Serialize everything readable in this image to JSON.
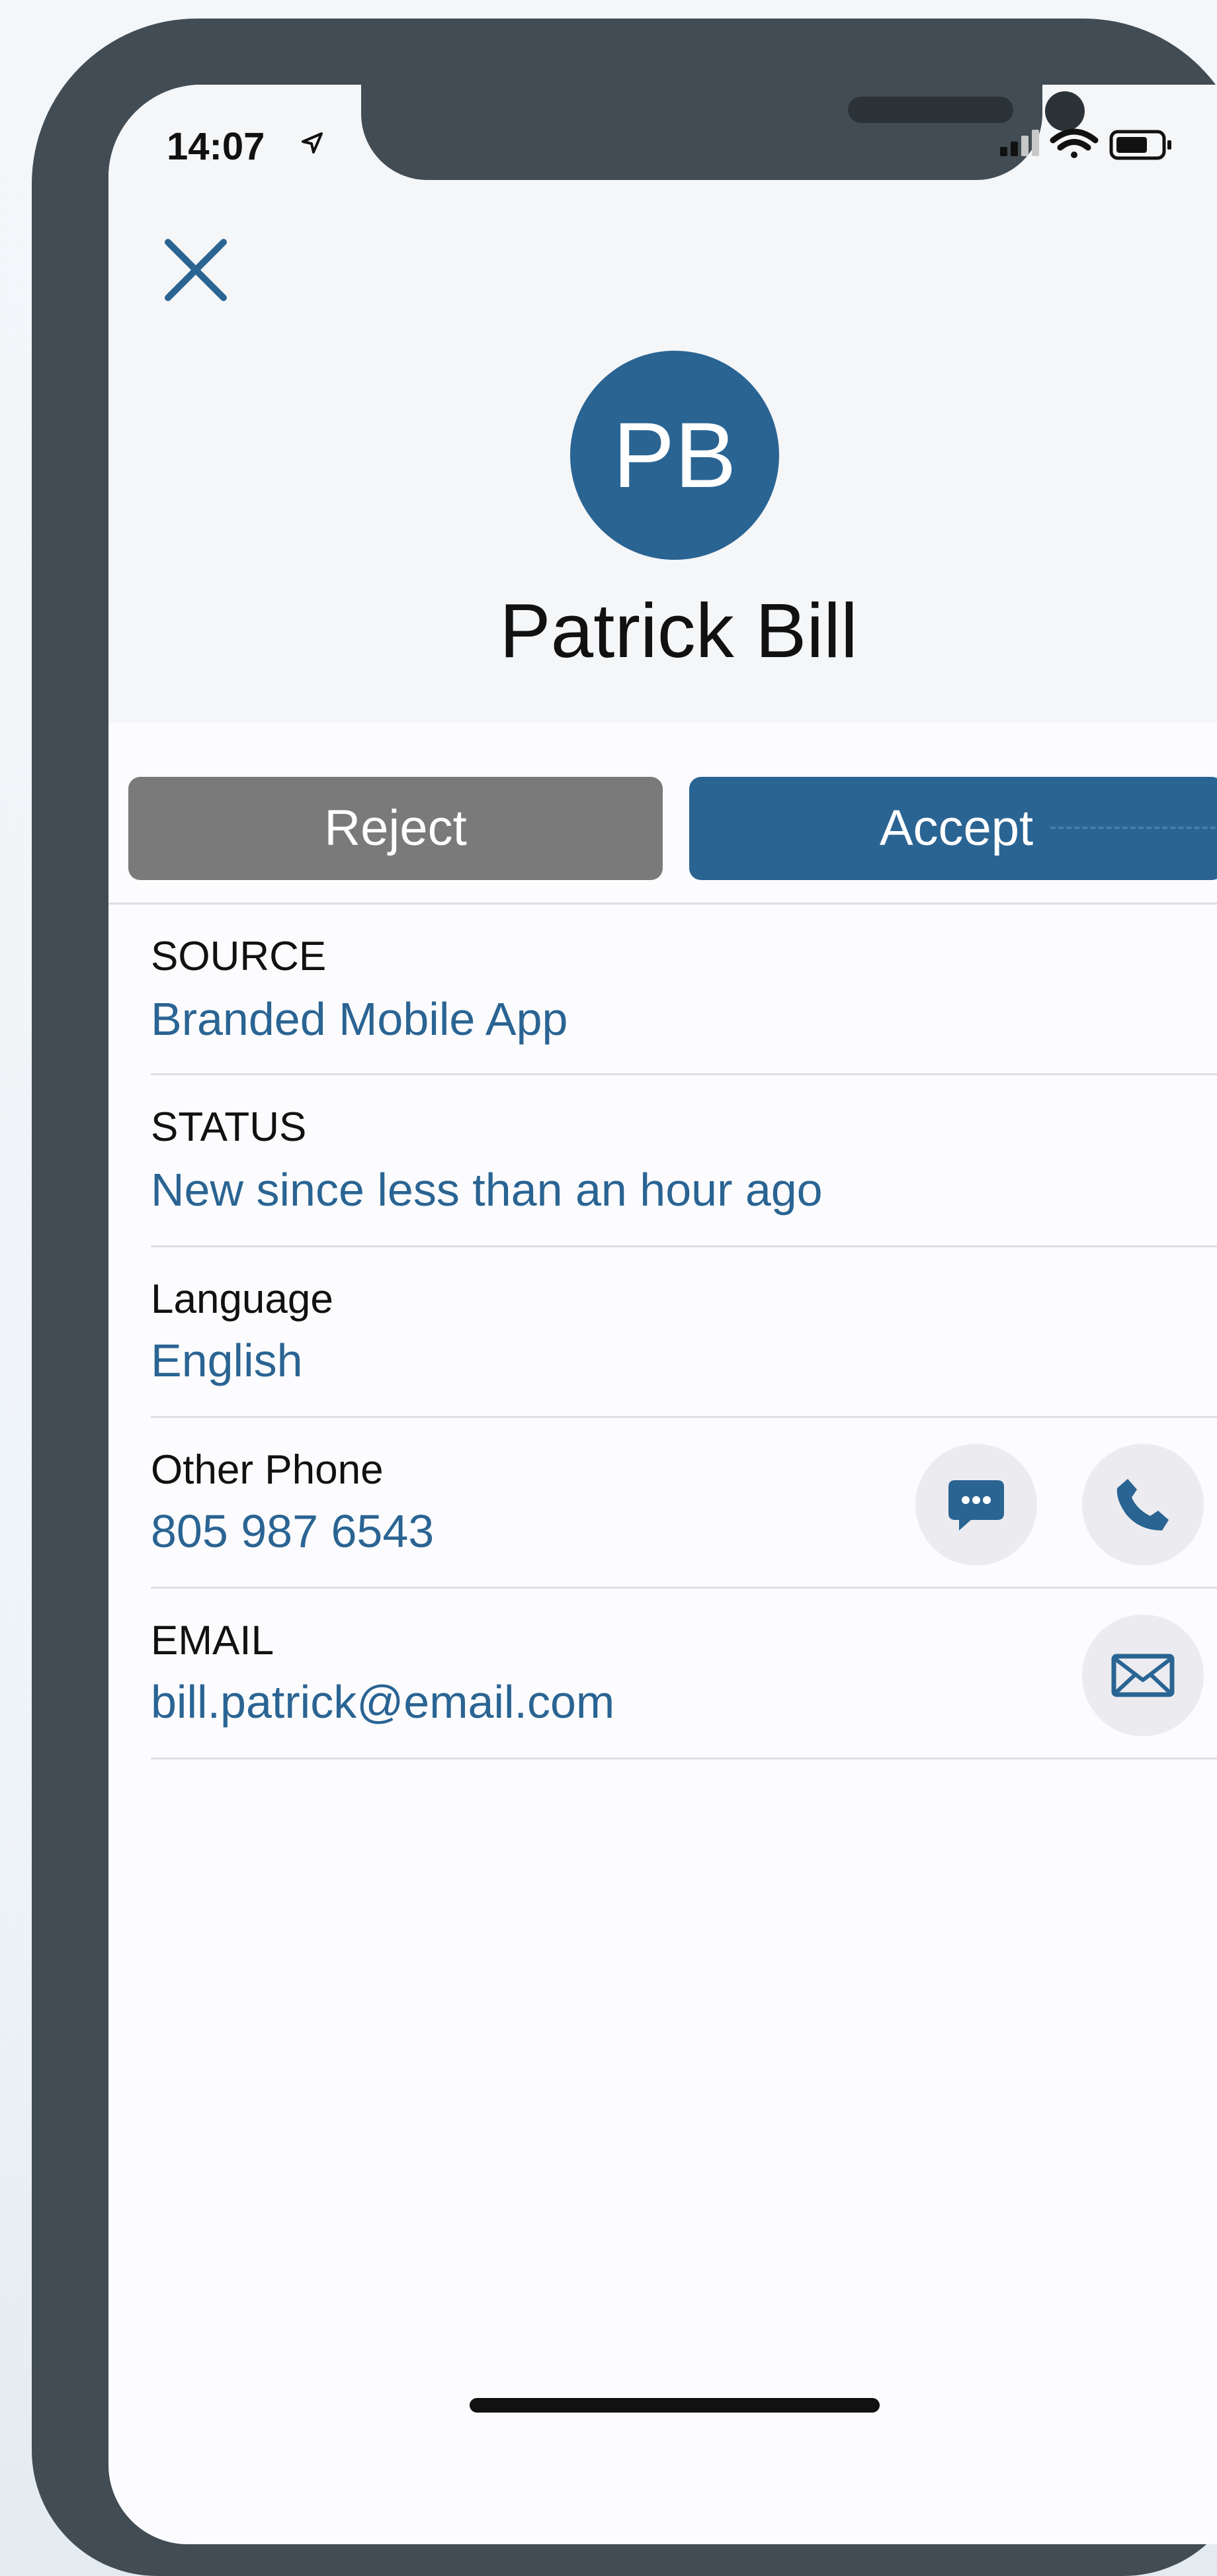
{
  "status_bar": {
    "time": "14:07"
  },
  "contact": {
    "initials": "PB",
    "name": "Patrick Bill"
  },
  "actions": {
    "reject_label": "Reject",
    "accept_label": "Accept"
  },
  "fields": [
    {
      "label": "SOURCE",
      "value": "Branded Mobile App"
    },
    {
      "label": "STATUS",
      "value": "New since less than an hour ago"
    },
    {
      "label": "Language",
      "value": "English"
    },
    {
      "label": "Other Phone",
      "value": "805 987 6543"
    },
    {
      "label": "EMAIL",
      "value": "bill.patrick@email.com"
    }
  ],
  "icons": {
    "close": "close-icon",
    "sms": "message-icon",
    "call": "phone-icon",
    "email": "mail-icon",
    "location": "location-arrow-icon",
    "signal": "signal-icon",
    "wifi": "wifi-icon",
    "battery": "battery-icon"
  },
  "colors": {
    "accent": "#2a6493",
    "reject": "#7a7a7a",
    "frame": "#414c54",
    "icon_circle": "#ececf0"
  }
}
